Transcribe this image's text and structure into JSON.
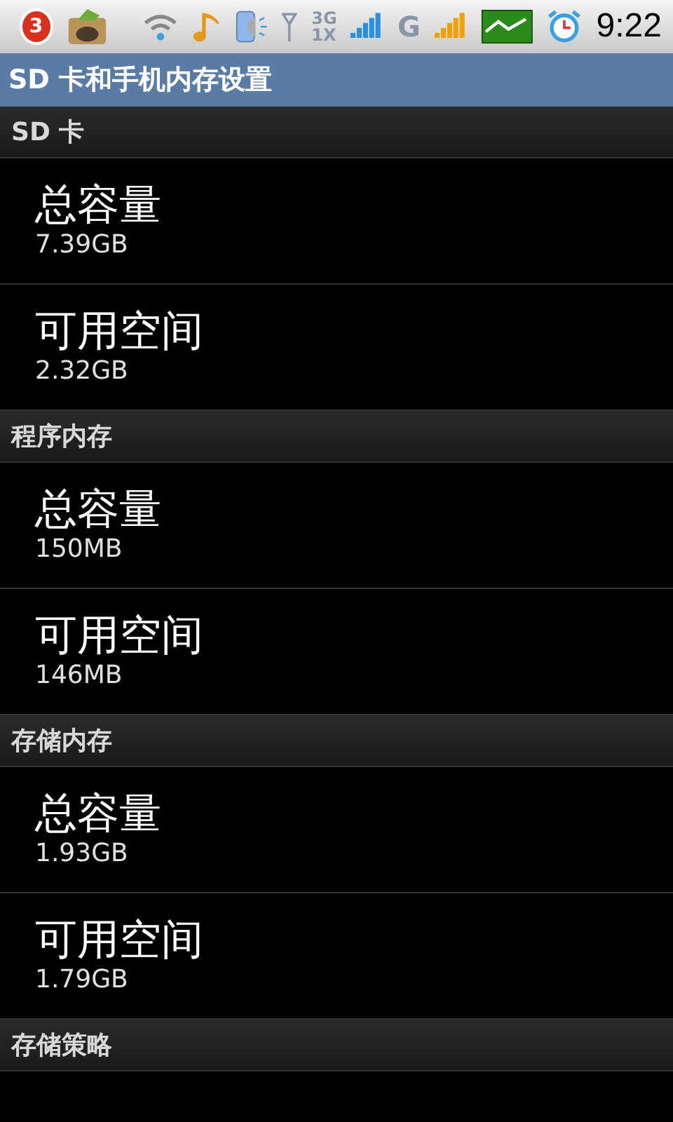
{
  "status_bar": {
    "notification_count": "3",
    "network_1": "3G",
    "network_2": "1X",
    "network_3": "G",
    "time": "9:22"
  },
  "title": "SD 卡和手机内存设置",
  "sections": [
    {
      "header": "SD 卡",
      "items": [
        {
          "title": "总容量",
          "value": "7.39GB"
        },
        {
          "title": "可用空间",
          "value": "2.32GB"
        }
      ]
    },
    {
      "header": "程序内存",
      "items": [
        {
          "title": "总容量",
          "value": "150MB"
        },
        {
          "title": "可用空间",
          "value": "146MB"
        }
      ]
    },
    {
      "header": "存储内存",
      "items": [
        {
          "title": "总容量",
          "value": "1.93GB"
        },
        {
          "title": "可用空间",
          "value": "1.79GB"
        }
      ]
    },
    {
      "header": "存储策略"
    }
  ]
}
